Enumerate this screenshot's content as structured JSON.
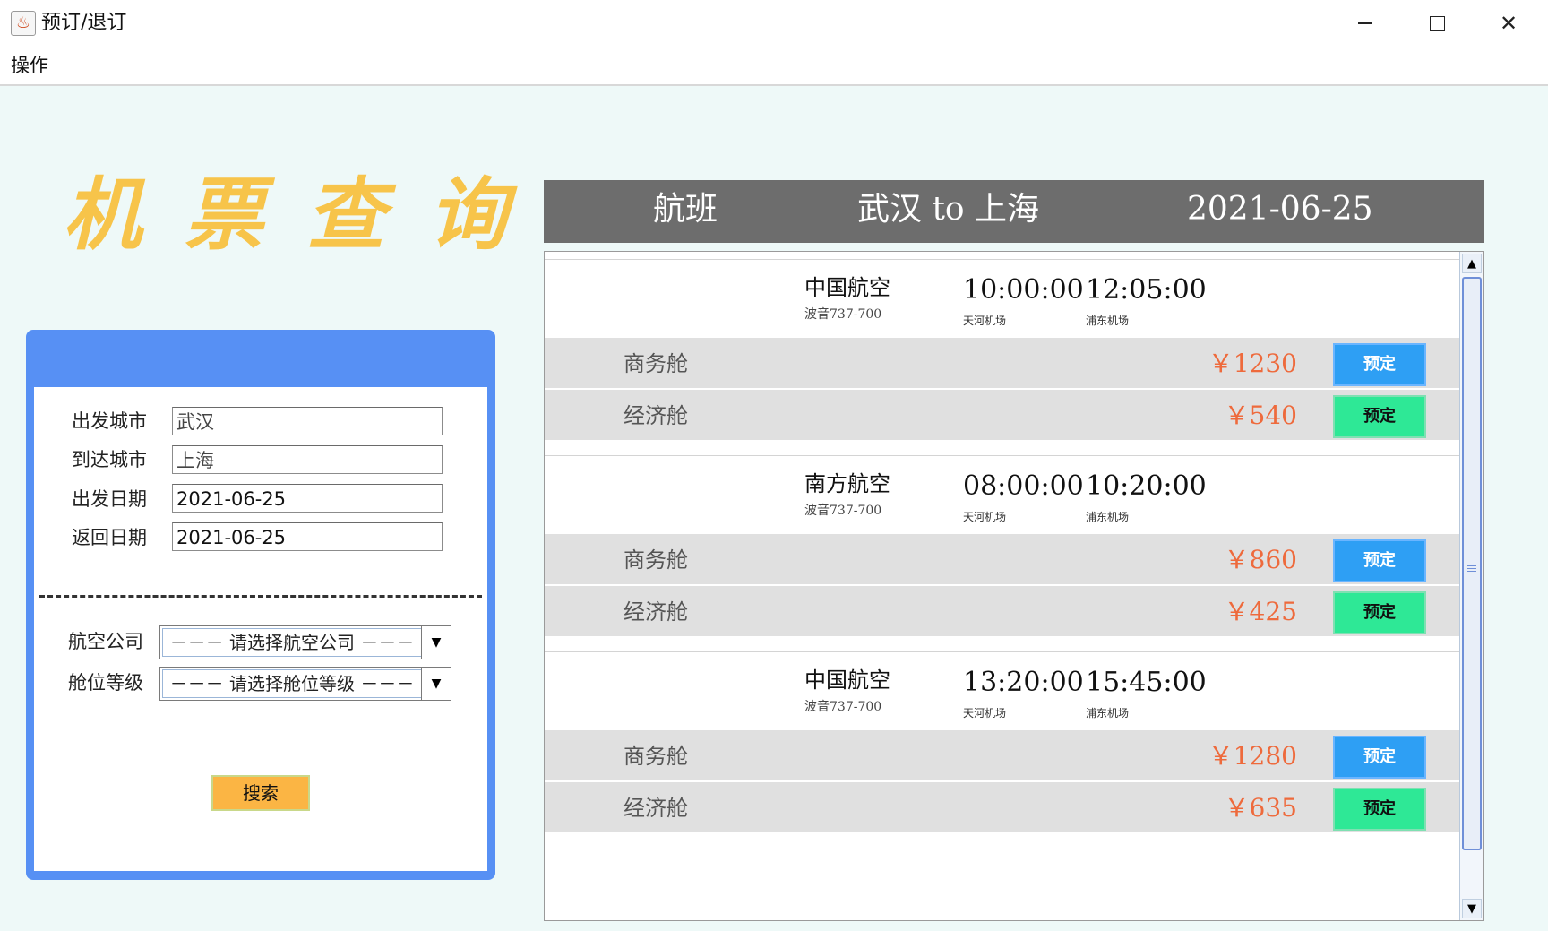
{
  "window": {
    "title": "预订/退订",
    "app_icon": "java-cup-icon"
  },
  "menu": {
    "items": [
      "操作"
    ]
  },
  "page_title": "机票查询",
  "search": {
    "labels": {
      "from": "出发城市",
      "to": "到达城市",
      "depart_date": "出发日期",
      "return_date": "返回日期",
      "airline": "航空公司",
      "cabin": "舱位等级"
    },
    "values": {
      "from": "武汉",
      "to": "上海",
      "depart_date": "2021-06-25",
      "return_date": "2021-06-25"
    },
    "airline_select": "－－－ 请选择航空公司 －－－",
    "cabin_select": "－－－ 请选择舱位等级 －－－",
    "button": "搜索"
  },
  "header": {
    "label": "航班",
    "route": "武汉 to 上海",
    "date": "2021-06-25"
  },
  "flights": [
    {
      "airline": "中国航空",
      "plane": "波音737-700",
      "depart_time": "10:00:00",
      "arrive_time": "12:05:00",
      "depart_airport": "天河机场",
      "arrive_airport": "浦东机场",
      "fares": [
        {
          "cabin": "商务舱",
          "price": "￥1230",
          "button": "预定"
        },
        {
          "cabin": "经济舱",
          "price": "￥540",
          "button": "预定"
        }
      ]
    },
    {
      "airline": "南方航空",
      "plane": "波音737-700",
      "depart_time": "08:00:00",
      "arrive_time": "10:20:00",
      "depart_airport": "天河机场",
      "arrive_airport": "浦东机场",
      "fares": [
        {
          "cabin": "商务舱",
          "price": "￥860",
          "button": "预定"
        },
        {
          "cabin": "经济舱",
          "price": "￥425",
          "button": "预定"
        }
      ]
    },
    {
      "airline": "中国航空",
      "plane": "波音737-700",
      "depart_time": "13:20:00",
      "arrive_time": "15:45:00",
      "depart_airport": "天河机场",
      "arrive_airport": "浦东机场",
      "fares": [
        {
          "cabin": "商务舱",
          "price": "￥1280",
          "button": "预定"
        },
        {
          "cabin": "经济舱",
          "price": "￥635",
          "button": "预定"
        }
      ]
    }
  ],
  "colors": {
    "title": "#f7c44a",
    "panel": "#5790f4",
    "header": "#6d6d6d",
    "price": "#ee6a3c",
    "business_button": "#2e9ff4",
    "economy_button": "#2ee896",
    "search_button": "#fbb544"
  }
}
